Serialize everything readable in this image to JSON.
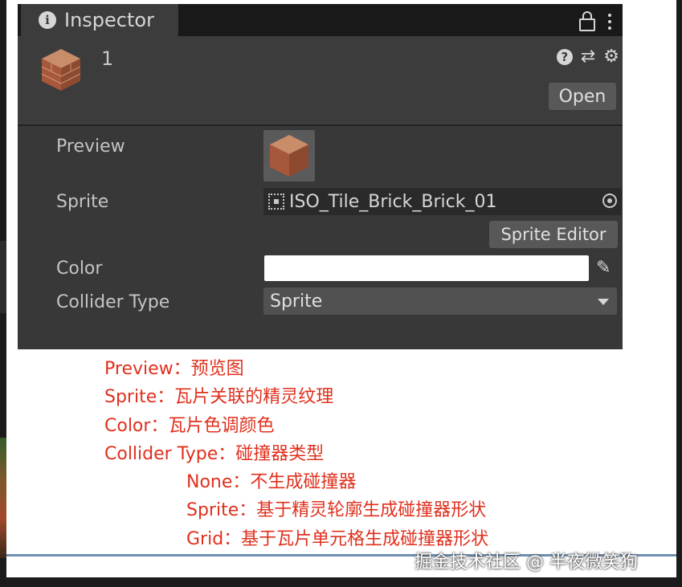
{
  "inspector": {
    "tab_title": "Inspector",
    "asset_name": "1",
    "open_label": "Open",
    "fields": {
      "preview_label": "Preview",
      "sprite_label": "Sprite",
      "sprite_value": "ISO_Tile_Brick_Brick_01",
      "sprite_editor_label": "Sprite Editor",
      "color_label": "Color",
      "color_value": "#ffffff",
      "collider_type_label": "Collider Type",
      "collider_type_value": "Sprite"
    }
  },
  "notes": [
    "Preview：预览图",
    "Sprite：瓦片关联的精灵纹理",
    "Color：瓦片色调颜色",
    "Collider Type：碰撞器类型",
    "None：不生成碰撞器",
    "Sprite：基于精灵轮廓生成碰撞器形状",
    "Grid：基于瓦片单元格生成碰撞器形状"
  ],
  "watermark": "掘金技术社区 @ 半夜微笑狗",
  "colors": {
    "panel_bg": "#383838",
    "annotation_red": "#e0301e",
    "divider_blue": "#6f8fb0"
  },
  "icons": [
    "info-icon",
    "lock-icon",
    "kebab-icon",
    "help-icon",
    "sliders-icon",
    "gear-icon",
    "sprite-thumb-icon",
    "picker-icon",
    "eyedropper-icon",
    "caret-down-icon"
  ]
}
